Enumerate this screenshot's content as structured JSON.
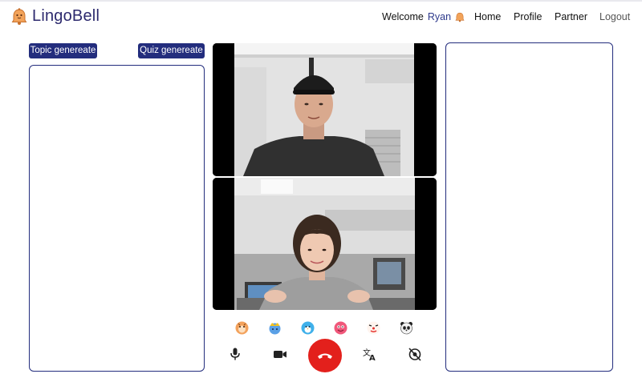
{
  "app": {
    "name": "LingoBell"
  },
  "header": {
    "welcome_label": "Welcome",
    "username": "Ryan",
    "nav": {
      "home": "Home",
      "profile": "Profile",
      "partner": "Partner",
      "logout": "Logout"
    }
  },
  "left_panel": {
    "topic_button": "Topic genereate",
    "quiz_button": "Quiz genereate"
  },
  "colors": {
    "brand_navy": "#232d7d",
    "hangup_red": "#e3201c",
    "logo_text": "#2d2a6e"
  },
  "reactions": [
    "tiger-face",
    "gold-crown-face",
    "blue-bird-face",
    "pink-monster-face",
    "clown-face",
    "panda-face"
  ],
  "controls": [
    "microphone-icon",
    "video-camera-icon",
    "hang-up-icon",
    "translate-icon",
    "camera-off-icon"
  ]
}
